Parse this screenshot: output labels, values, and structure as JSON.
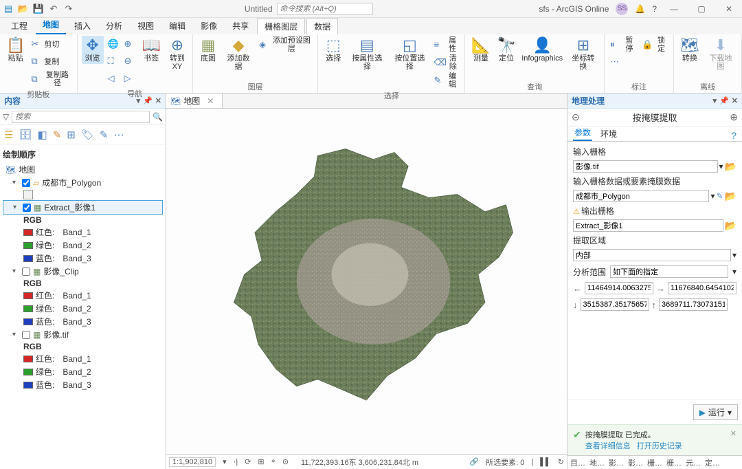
{
  "titlebar": {
    "title": "Untitled",
    "search_placeholder": "命令搜索 (Alt+Q)",
    "user_label": "sfs - ArcGIS Online",
    "avatar": "SS"
  },
  "ribbon_tabs": [
    "工程",
    "地图",
    "插入",
    "分析",
    "视图",
    "编辑",
    "影像",
    "共享",
    "栅格图层",
    "数据"
  ],
  "ribbon": {
    "clipboard": {
      "title": "剪贴板",
      "paste": "粘贴",
      "cut": "剪切",
      "copy": "复制",
      "copy_path": "复制路径"
    },
    "navigate": {
      "title": "导航",
      "explore": "浏览",
      "bookmarks": "书签",
      "goto": "转到\nXY"
    },
    "layer": {
      "title": "图层",
      "basemap": "底图",
      "add_data": "添加数据",
      "add_preset": "添加预设图层"
    },
    "selection": {
      "title": "选择",
      "select": "选择",
      "select_attr": "按属性选择",
      "select_loc": "按位置选择",
      "properties": "属性",
      "clear": "清除",
      "edit": "编辑"
    },
    "inquiry": {
      "title": "查询",
      "measure": "测量",
      "locate": "定位",
      "infographics": "Infographics",
      "coord_convert": "坐标转换"
    },
    "labeling": {
      "title": "标注",
      "pause": "暂停",
      "lock": "锁定",
      "more_items": "⋯"
    },
    "offline": {
      "title": "离线",
      "convert": "转换",
      "download": "下载地图"
    }
  },
  "content_pane": {
    "title": "内容",
    "search_placeholder": "搜索",
    "drawing_order": "绘制顺序",
    "map": "地图",
    "layers": [
      {
        "name": "成都市_Polygon",
        "checked": true,
        "type": "polygon"
      },
      {
        "name": "Extract_影像1",
        "checked": true,
        "type": "raster",
        "selected": true,
        "rgb_label": "RGB",
        "bands": [
          {
            "color": "#d62728",
            "label": "红色:",
            "band": "Band_1"
          },
          {
            "color": "#2ca02c",
            "label": "绿色:",
            "band": "Band_2"
          },
          {
            "color": "#1f3fbf",
            "label": "蓝色:",
            "band": "Band_3"
          }
        ]
      },
      {
        "name": "影像_Clip",
        "checked": false,
        "type": "raster",
        "rgb_label": "RGB",
        "bands": [
          {
            "color": "#d62728",
            "label": "红色:",
            "band": "Band_1"
          },
          {
            "color": "#2ca02c",
            "label": "绿色:",
            "band": "Band_2"
          },
          {
            "color": "#1f3fbf",
            "label": "蓝色:",
            "band": "Band_3"
          }
        ]
      },
      {
        "name": "影像.tif",
        "checked": false,
        "type": "raster",
        "rgb_label": "RGB",
        "bands": [
          {
            "color": "#d62728",
            "label": "红色:",
            "band": "Band_1"
          },
          {
            "color": "#2ca02c",
            "label": "绿色:",
            "band": "Band_2"
          },
          {
            "color": "#1f3fbf",
            "label": "蓝色:",
            "band": "Band_3"
          }
        ]
      }
    ]
  },
  "map_pane": {
    "tab": "地图",
    "scale": "1:1,902,810",
    "coords": "11,722,393.16东 3,606,231.84北 m",
    "selected_elements": "所选要素: 0"
  },
  "gp_pane": {
    "title": "地理处理",
    "tool_name": "按掩膜提取",
    "tabs": {
      "params": "参数",
      "env": "环境"
    },
    "params": {
      "input_raster_label": "输入栅格",
      "input_raster_value": "影像.tif",
      "mask_label": "输入栅格数据或要素掩膜数据",
      "mask_value": "成都市_Polygon",
      "output_raster_label": "输出栅格",
      "output_raster_value": "Extract_影像1",
      "extract_area_label": "提取区域",
      "extract_area_value": "内部",
      "extent_label": "分析范围",
      "extent_mode": "如下面的指定",
      "extent": {
        "left": "11464914.0063275",
        "right": "11676840.6454102",
        "bottom": "3515387.35175657",
        "top": "3689711.73073151"
      }
    },
    "run": "运行",
    "message": {
      "text": "按掩膜提取 已完成。",
      "details_link": "查看详细信息",
      "history_link": "打开历史记录"
    }
  },
  "bottom_tabs": [
    "目…",
    "地…",
    "影…",
    "影…",
    "栅…",
    "栅…",
    "元…",
    "定…"
  ]
}
